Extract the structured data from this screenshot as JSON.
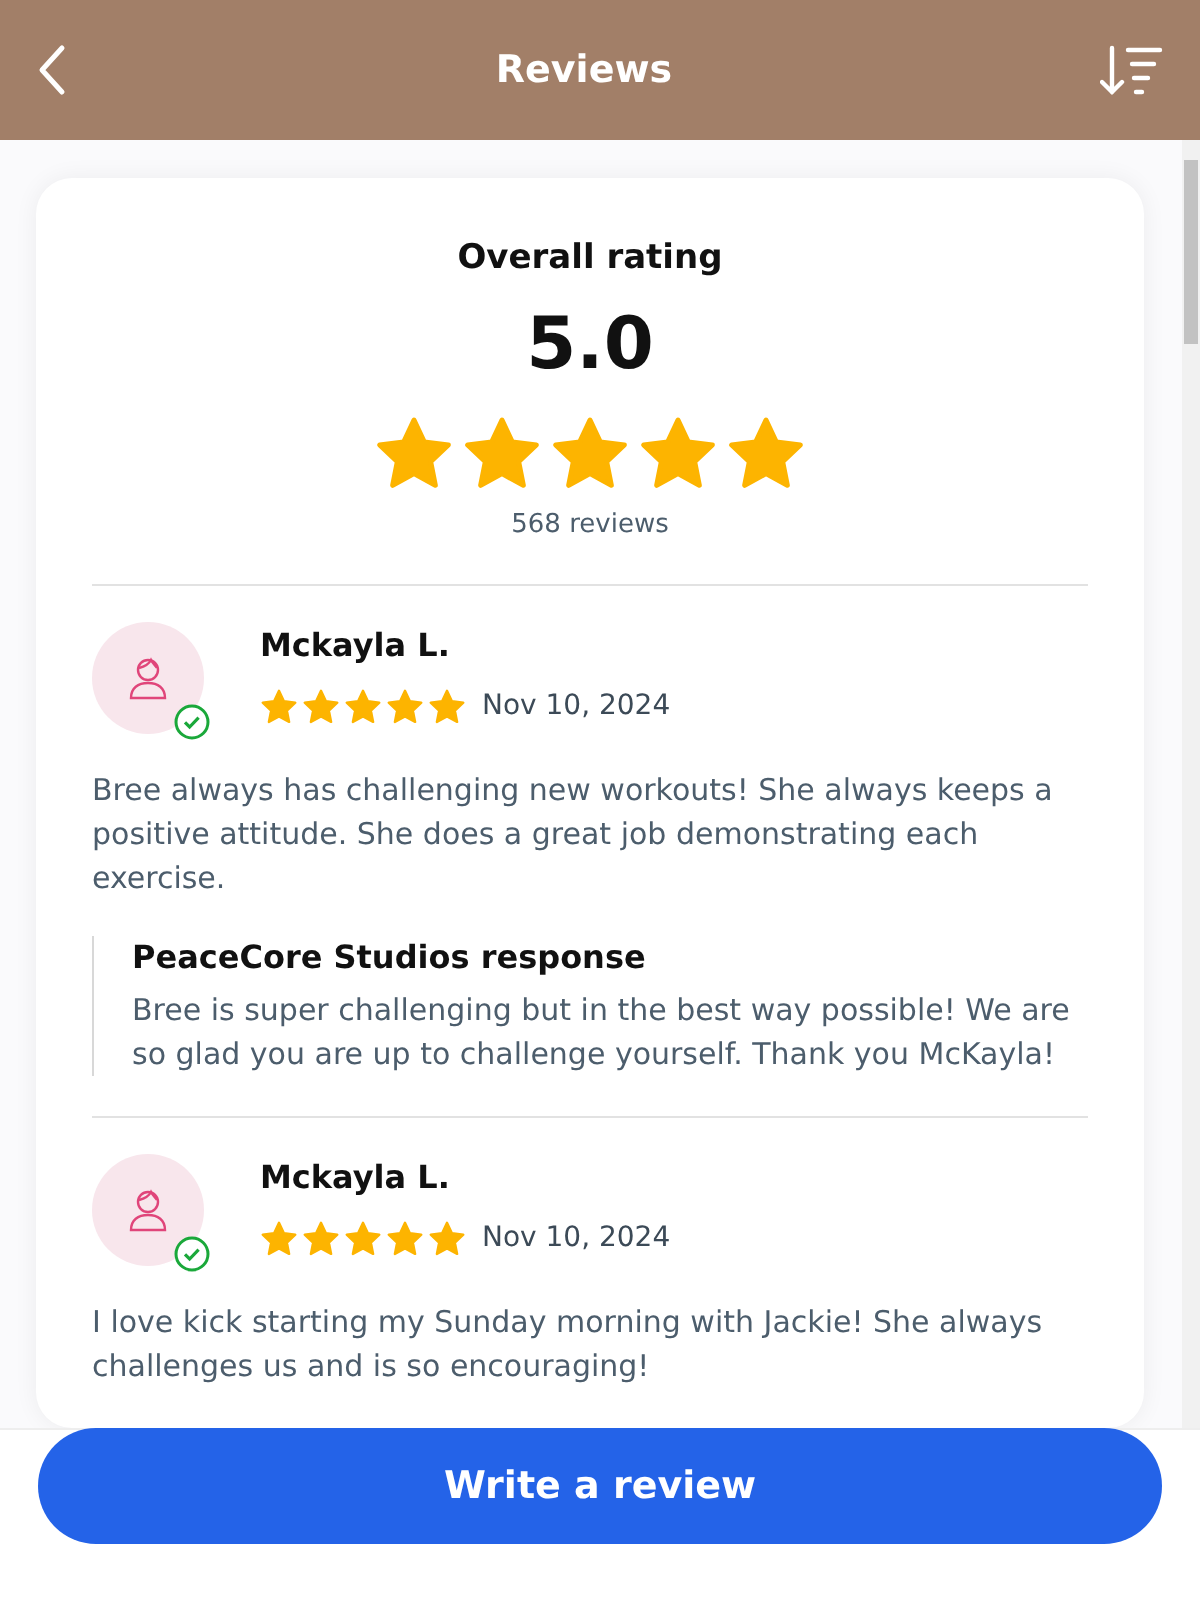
{
  "header": {
    "title": "Reviews"
  },
  "summary": {
    "heading": "Overall rating",
    "score": "5.0",
    "stars": 5,
    "count": "568 reviews"
  },
  "reviews": [
    {
      "name": "Mckayla L.",
      "verified": true,
      "stars": 5,
      "date": "Nov 10, 2024",
      "text": "Bree always has challenging new workouts! She always keeps a positive attitude. She does a great job demonstrating each exercise.",
      "response": {
        "title": "PeaceCore Studios response",
        "text": "Bree is super challenging but in the best way possible! We are so glad you are up to challenge yourself. Thank you McKayla!"
      }
    },
    {
      "name": "Mckayla L.",
      "verified": true,
      "stars": 5,
      "date": "Nov 10, 2024",
      "text": "I love kick starting my Sunday morning with Jackie! She always challenges us and is so encouraging!"
    }
  ],
  "footer": {
    "button": "Write a review"
  }
}
